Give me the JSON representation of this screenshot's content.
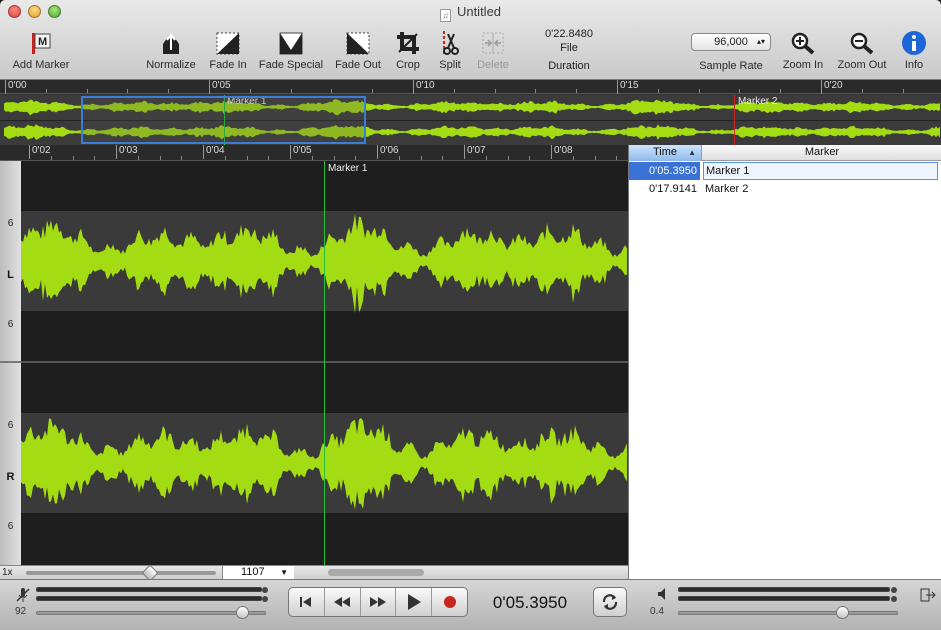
{
  "window": {
    "title": "Untitled"
  },
  "toolbar": {
    "add_marker": "Add Marker",
    "normalize": "Normalize",
    "fade_in": "Fade In",
    "fade_special": "Fade Special",
    "fade_out": "Fade Out",
    "crop": "Crop",
    "split": "Split",
    "delete": "Delete",
    "duration_value": "0'22.8480",
    "duration_sub": "File",
    "duration_label": "Duration",
    "sample_rate_value": "96,000",
    "sample_rate_label": "Sample Rate",
    "zoom_in": "Zoom In",
    "zoom_out": "Zoom Out",
    "info": "Info"
  },
  "overview": {
    "ruler": [
      "0'00",
      "0'05",
      "0'10",
      "0'15",
      "0'20"
    ],
    "markers": [
      {
        "label": "Marker 1"
      },
      {
        "label": "Marker 2"
      }
    ]
  },
  "main": {
    "ruler": [
      "0'02",
      "0'03",
      "0'04",
      "0'05",
      "0'06",
      "0'07",
      "0'08"
    ],
    "marker_label": "Marker 1",
    "channels": [
      {
        "name": "L",
        "db_top": "6",
        "db_bottom": "6"
      },
      {
        "name": "R",
        "db_top": "6",
        "db_bottom": "6"
      }
    ],
    "zoom_factor": "1x",
    "zoom_value": "1107"
  },
  "markers_table": {
    "columns": {
      "time": "Time",
      "marker": "Marker"
    },
    "rows": [
      {
        "time": "0'05.3950",
        "name": "Marker 1"
      },
      {
        "time": "0'17.9141",
        "name": "Marker 2"
      }
    ]
  },
  "transport": {
    "input_level": "92",
    "counter": "0'05.3950",
    "output_volume": "0.4"
  },
  "colors": {
    "waveform": "#a4dc14",
    "selection": "#3b7cd9",
    "marker_line": "#22c23a",
    "marker2_line": "#c8261e"
  }
}
